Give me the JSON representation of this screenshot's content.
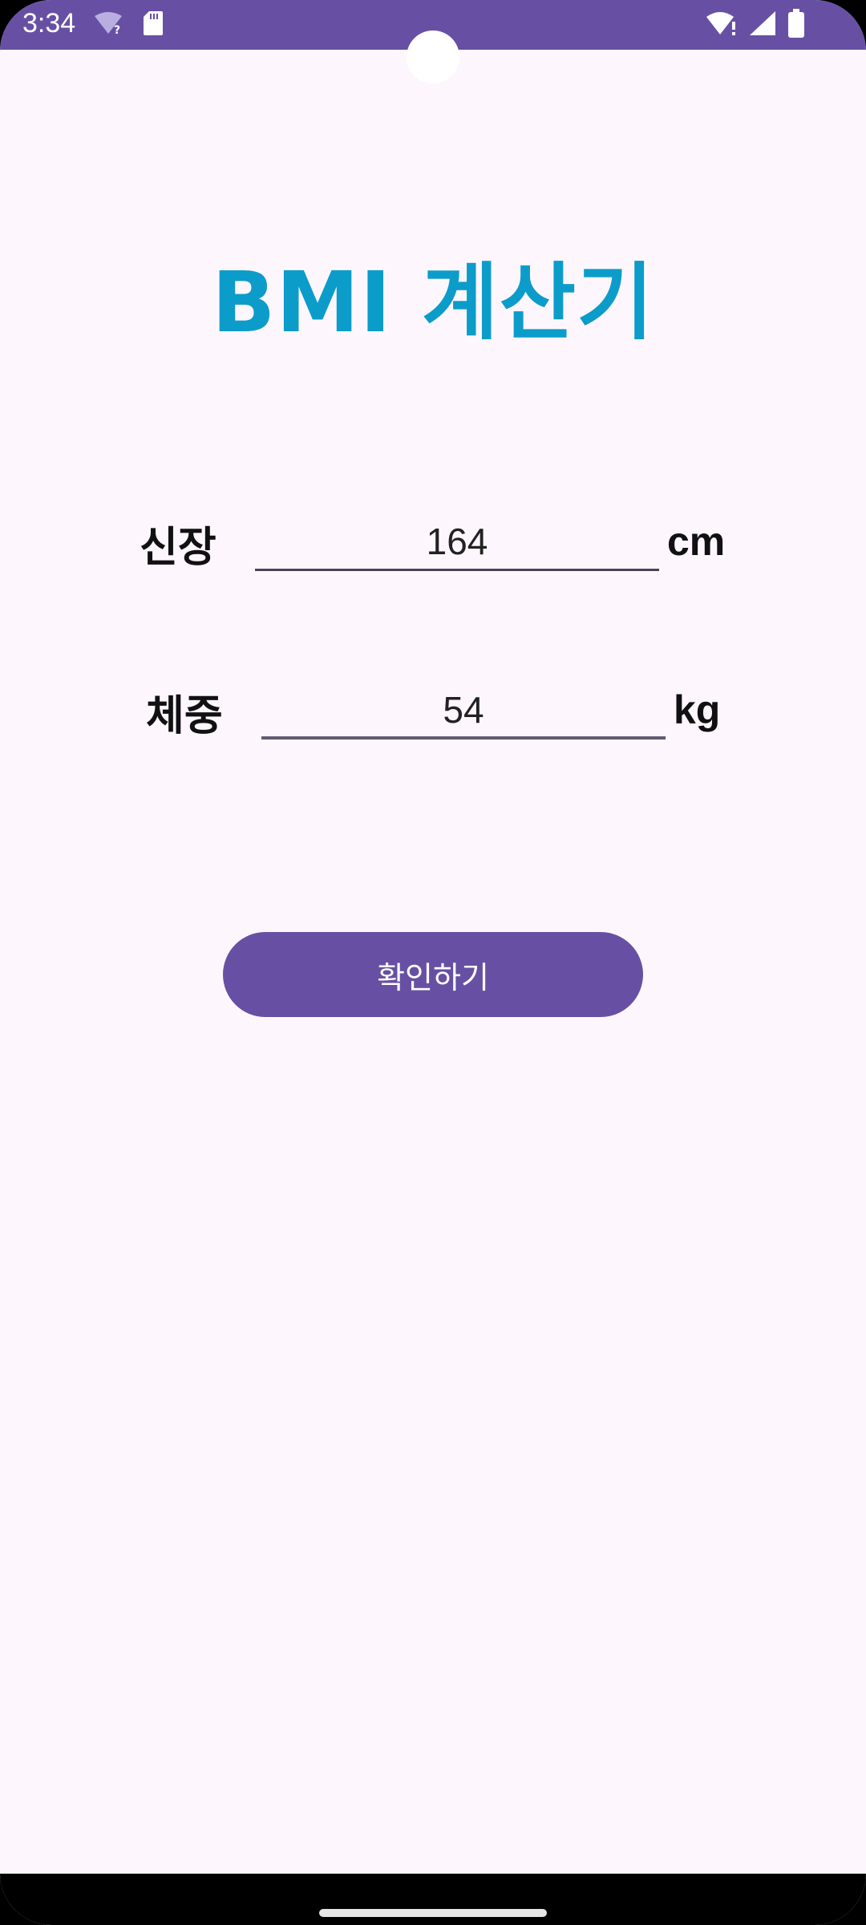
{
  "status_bar": {
    "time": "3:34",
    "background": "#6750a4",
    "icons_left": [
      "wifi-unknown-icon",
      "sd-card-icon"
    ],
    "icons_right": [
      "wifi-alert-icon",
      "signal-icon",
      "battery-icon"
    ]
  },
  "app": {
    "title": "BMI 계산기",
    "title_color": "#0c9cc9"
  },
  "form": {
    "height": {
      "label": "신장",
      "value": "164",
      "unit": "cm"
    },
    "weight": {
      "label": "체중",
      "value": "54",
      "unit": "kg"
    }
  },
  "confirm_button": {
    "label": "확인하기",
    "color": "#6750a4"
  }
}
